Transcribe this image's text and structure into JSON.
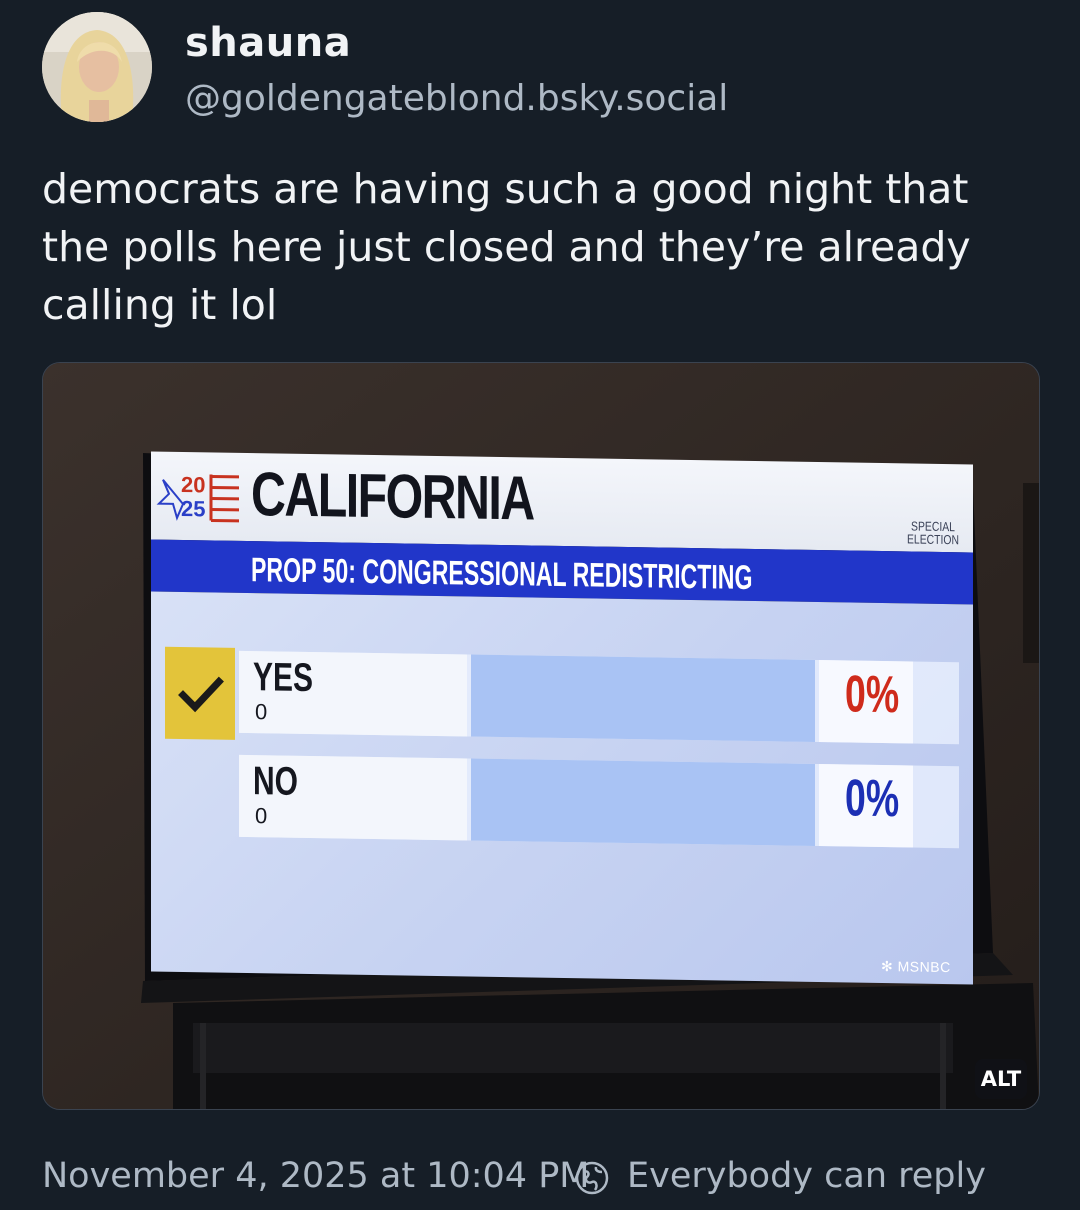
{
  "author": {
    "display_name": "shauna",
    "handle": "@goldengateblond.bsky.social"
  },
  "post": {
    "text": "democrats are having such a good night that the polls here just closed and they’re already calling it lol"
  },
  "media": {
    "alt_badge": "ALT",
    "tv": {
      "logo_year_top": "20",
      "logo_year_bottom": "25",
      "state": "CALIFORNIA",
      "election_line1": "SPECIAL",
      "election_line2": "ELECTION",
      "proposition": "PROP 50: CONGRESSIONAL REDISTRICTING",
      "results": [
        {
          "choice": "YES",
          "votes": "0",
          "percent": "0%",
          "called": true,
          "color": "#cf2b1c"
        },
        {
          "choice": "NO",
          "votes": "0",
          "percent": "0%",
          "called": false,
          "color": "#1c2fb4"
        }
      ],
      "network": "MSNBC"
    }
  },
  "footer": {
    "timestamp": "November 4, 2025 at 10:04 PM",
    "reply_setting": "Everybody can reply",
    "reply_icon": "earth-icon"
  },
  "colors": {
    "background": "#161e27",
    "secondary_text": "#aeb9c5",
    "tv_blue_bar": "#2136c9",
    "check_yellow": "#e3c43a"
  }
}
